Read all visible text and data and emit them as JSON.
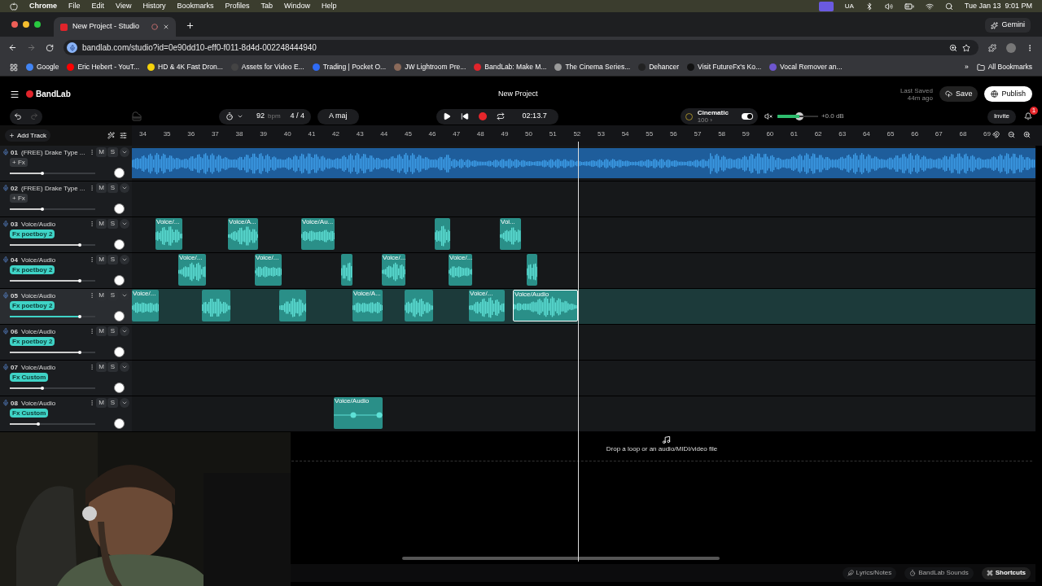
{
  "menubar": {
    "app": "Chrome",
    "menus": [
      "File",
      "Edit",
      "View",
      "History",
      "Bookmarks",
      "Profiles",
      "Tab",
      "Window",
      "Help"
    ],
    "input_source": "UA",
    "clock": "Tue Jan 13  9:01 PM"
  },
  "browser": {
    "tab": {
      "title": "New Project - Studio",
      "selected": true
    },
    "gemini": "Gemini",
    "url": "bandlab.com/studio?id=0e90dd10-eff0-f011-8d4d-002248444940",
    "bookmarks": [
      {
        "label": "Google",
        "color": "#4285f4"
      },
      {
        "label": "Eric Hebert - YouT...",
        "color": "#ff0000"
      },
      {
        "label": "HD & 4K Fast Dron...",
        "color": "#f5d20a"
      },
      {
        "label": "Assets for Video E...",
        "color": "#444444"
      },
      {
        "label": "Trading | Pocket O...",
        "color": "#2f6bf5"
      },
      {
        "label": "JW Lightroom Pre...",
        "color": "#8a6a5a"
      },
      {
        "label": "BandLab: Make M...",
        "color": "#e0242b"
      },
      {
        "label": "The Cinema Series...",
        "color": "#9a9a9a"
      },
      {
        "label": "Dehancer",
        "color": "#222222"
      },
      {
        "label": "Visit FutureFx's Ko...",
        "color": "#111111"
      },
      {
        "label": "Vocal Remover an...",
        "color": "#6e56cf"
      }
    ],
    "more": "»",
    "all_bookmarks": "All Bookmarks"
  },
  "app": {
    "logo": "BandLab",
    "project": "New Project",
    "last_saved": "Last Saved",
    "saved_ago": "44m ago",
    "save": "Save",
    "publish": "Publish",
    "invite": "Invite",
    "notifications": "1",
    "toolbar": {
      "bpm": "92",
      "bpm_unit": "bpm",
      "time_signature": "4 / 4",
      "key": "A maj",
      "time": "02:13.7",
      "preset": "Cinematic",
      "preset_value": "100 ›",
      "preset_on": true,
      "master": {
        "level": 0.55
      },
      "master_db": "+0.0 dB"
    },
    "add_track": "Add Track",
    "ruler": [
      "34",
      "35",
      "36",
      "37",
      "38",
      "39",
      "40",
      "41",
      "42",
      "43",
      "44",
      "45",
      "46",
      "47",
      "48",
      "49",
      "50",
      "51",
      "52",
      "53",
      "54",
      "55",
      "56",
      "57",
      "58",
      "59",
      "60",
      "61",
      "62",
      "63",
      "64",
      "65",
      "66",
      "67",
      "68",
      "69"
    ],
    "tracks": [
      {
        "number": "01",
        "name": "(FREE) Drake Type ...",
        "mute": "M",
        "solo": "S",
        "fx": {
          "kind": "add",
          "label": "+ Fx"
        },
        "level": 0.38,
        "selected": false,
        "kind": "beat"
      },
      {
        "number": "02",
        "name": "(FREE) Drake Type ...",
        "mute": "M",
        "solo": "S",
        "fx": {
          "kind": "add",
          "label": "+ Fx"
        },
        "level": 0.38,
        "selected": false,
        "kind": "beat-empty"
      },
      {
        "number": "03",
        "name": "Voice/Audio",
        "mute": "M",
        "solo": "S",
        "fx": {
          "kind": "preset",
          "label": "Fx poetboy 2"
        },
        "level": 0.82,
        "selected": false,
        "kind": "voice",
        "clips": [
          {
            "label": "Voice/...",
            "selected": false
          },
          {
            "label": "Voice/A...",
            "selected": false
          },
          {
            "label": "Voice/Au...",
            "selected": false
          },
          {
            "selected": false
          },
          {
            "label": "Voi...",
            "selected": false
          }
        ]
      },
      {
        "number": "04",
        "name": "Voice/Audio",
        "mute": "M",
        "solo": "S",
        "fx": {
          "kind": "preset",
          "label": "Fx poetboy 2"
        },
        "level": 0.82,
        "selected": false,
        "kind": "voice",
        "clips": [
          {
            "label": "Voice/...",
            "selected": false
          },
          {
            "label": "Voice/...",
            "selected": false
          },
          {
            "selected": false
          },
          {
            "label": "Voice/...",
            "selected": false
          },
          {
            "label": "Voice/...",
            "selected": false
          },
          {
            "selected": false
          }
        ]
      },
      {
        "number": "05",
        "name": "Voice/Audio",
        "mute": "M",
        "solo": "S",
        "fx": {
          "kind": "preset",
          "label": "Fx poetboy 2"
        },
        "level": 0.82,
        "selected": true,
        "kind": "voice",
        "clips": [
          {
            "label": "Voice/...",
            "selected": false
          },
          {
            "selected": false
          },
          {
            "selected": false
          },
          {
            "label": "Voice/A...",
            "selected": false
          },
          {
            "selected": false
          },
          {
            "label": "Voice/...",
            "selected": false
          },
          {
            "label": "Voice/Audio",
            "selected": true
          }
        ]
      },
      {
        "number": "06",
        "name": "Voice/Audio",
        "mute": "M",
        "solo": "S",
        "fx": {
          "kind": "preset",
          "label": "Fx poetboy 2"
        },
        "level": 0.82,
        "selected": false,
        "kind": "voice"
      },
      {
        "number": "07",
        "name": "Voice/Audio",
        "mute": "M",
        "solo": "S",
        "fx": {
          "kind": "preset",
          "label": "Fx Custom"
        },
        "level": 0.38,
        "selected": false,
        "kind": "voice"
      },
      {
        "number": "08",
        "name": "Voice/Audio",
        "mute": "M",
        "solo": "S",
        "fx": {
          "kind": "preset",
          "label": "Fx Custom"
        },
        "level": 0.33,
        "selected": false,
        "kind": "voice",
        "clips": [
          {
            "label": "Voice/Audio",
            "selected": false
          }
        ]
      }
    ],
    "drop_hint": "Drop a loop or an audio/MIDI/video file",
    "footer": [
      "Lyrics/Notes",
      "BandLab Sounds",
      "Shortcuts"
    ]
  }
}
